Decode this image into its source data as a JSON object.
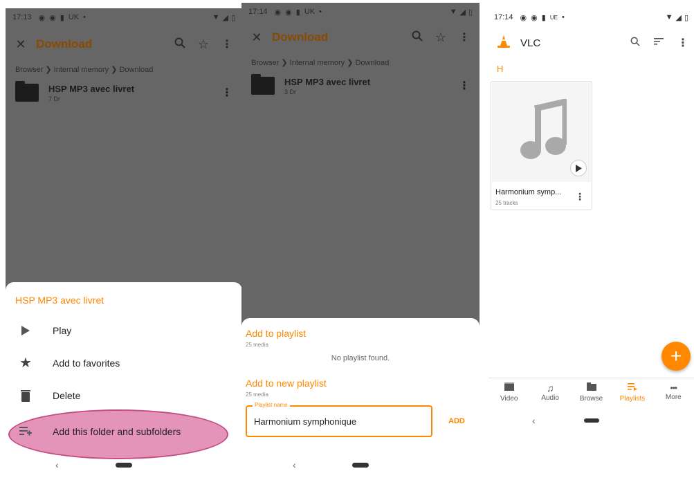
{
  "screen1": {
    "status": {
      "time": "17:13",
      "sim": "UK"
    },
    "toolbar": {
      "title": "Download"
    },
    "breadcrumb": "Browser ❯ Internal memory ❯ Download",
    "folder": {
      "name": "HSP MP3 avec livret",
      "sub": "7 Dr"
    },
    "sheet": {
      "title": "HSP MP3 avec livret",
      "items": [
        {
          "label": "Play",
          "icon": "play-icon"
        },
        {
          "label": "Add to favorites",
          "icon": "star-icon"
        },
        {
          "label": "Delete",
          "icon": "trash-icon"
        },
        {
          "label": "Add this folder and subfolders",
          "icon": "playlist-add-icon"
        }
      ]
    },
    "nav_back": "‹"
  },
  "screen2": {
    "status": {
      "time": "17:14",
      "sim": "UK"
    },
    "toolbar": {
      "title": "Download"
    },
    "breadcrumb": "Browser ❯ Internal memory ❯ Download",
    "folder": {
      "name": "HSP MP3 avec livret",
      "sub": "3 Dr"
    },
    "sheet": {
      "title": "Add to playlist",
      "subtitle": "25 media",
      "empty": "No playlist found.",
      "new_title": "Add to new playlist",
      "new_subtitle": "25 media",
      "field_label": "Playlist name",
      "field_value": "Harmonium symphonique",
      "add": "ADD"
    },
    "nav_back": "‹"
  },
  "screen3": {
    "status": {
      "time": "17:14",
      "sim": "UE"
    },
    "app_title": "VLC",
    "section": "H",
    "card": {
      "title": "Harmonium symp...",
      "subtitle": "25 tracks"
    },
    "fab": "+",
    "bottom_nav": [
      {
        "label": "Video",
        "icon": "video-icon"
      },
      {
        "label": "Audio",
        "icon": "audio-icon"
      },
      {
        "label": "Browse",
        "icon": "folder-icon"
      },
      {
        "label": "Playlists",
        "icon": "playlist-icon",
        "active": true
      },
      {
        "label": "More",
        "icon": "more-icon"
      }
    ],
    "nav_back": "‹"
  },
  "colors": {
    "accent": "#ff8800",
    "scrim": "#666666",
    "highlight": "#e48fb6"
  }
}
